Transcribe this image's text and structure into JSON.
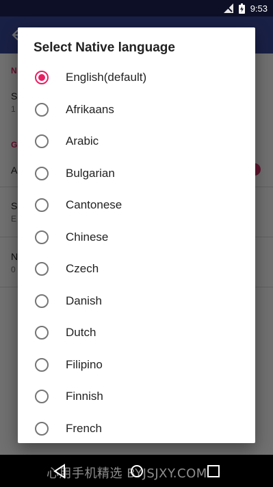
{
  "status_bar": {
    "time": "9:53"
  },
  "dialog": {
    "title": "Select Native language",
    "selected_index": 0,
    "options": [
      {
        "label": "English(default)",
        "checked": true
      },
      {
        "label": "Afrikaans",
        "checked": false
      },
      {
        "label": "Arabic",
        "checked": false
      },
      {
        "label": "Bulgarian",
        "checked": false
      },
      {
        "label": "Cantonese",
        "checked": false
      },
      {
        "label": "Chinese",
        "checked": false
      },
      {
        "label": "Czech",
        "checked": false
      },
      {
        "label": "Danish",
        "checked": false
      },
      {
        "label": "Dutch",
        "checked": false
      },
      {
        "label": "Filipino",
        "checked": false
      },
      {
        "label": "Finnish",
        "checked": false
      },
      {
        "label": "French",
        "checked": false
      }
    ]
  },
  "watermark": "心用手机精选 BYJSJXY.COM",
  "colors": {
    "accent": "#e91e63",
    "toolbar": "#3a4a9d",
    "status_bar": "#0d0f26"
  }
}
